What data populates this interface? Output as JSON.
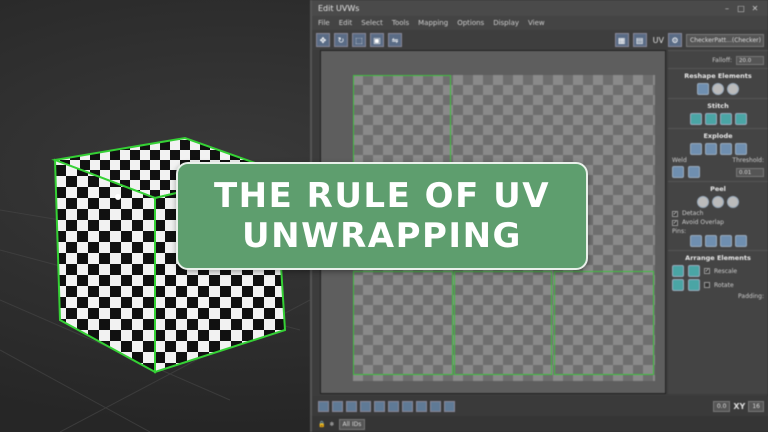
{
  "overlay": {
    "title_line1": "THE RULE OF UV",
    "title_line2": "UNWRAPPING"
  },
  "uv_editor": {
    "window_title": "Edit UVWs",
    "menu": [
      "File",
      "Edit",
      "Select",
      "Tools",
      "Mapping",
      "Options",
      "Display",
      "View"
    ],
    "toolbar": {
      "uv_label": "UV",
      "checker_value": "CheckerPatt...(Checker)"
    },
    "panel": {
      "falloff_label": "Falloff:",
      "falloff_value": "20.0",
      "sections": {
        "reshape": "Reshape Elements",
        "stitch": "Stitch",
        "explode": "Explode",
        "peel": "Peel",
        "arrange": "Arrange Elements"
      },
      "weld_label": "Weld",
      "threshold_label": "Threshold:",
      "threshold_value": "0.01",
      "detach_label": "Detach",
      "avoid_overlap_label": "Avoid Overlap",
      "pins_label": "Pins:",
      "rescale_label": "Rescale",
      "rotate_label": "Rotate",
      "padding_label": "Padding:"
    },
    "bottom": {
      "value_field": "0.0",
      "xy_label": "XY",
      "zoom_field": "16",
      "ids_field": "All IDs"
    }
  },
  "colors": {
    "card_green": "#5e9e6e",
    "uv_shell_green": "#3fbf3f",
    "accent_blue": "#5a6c86"
  }
}
